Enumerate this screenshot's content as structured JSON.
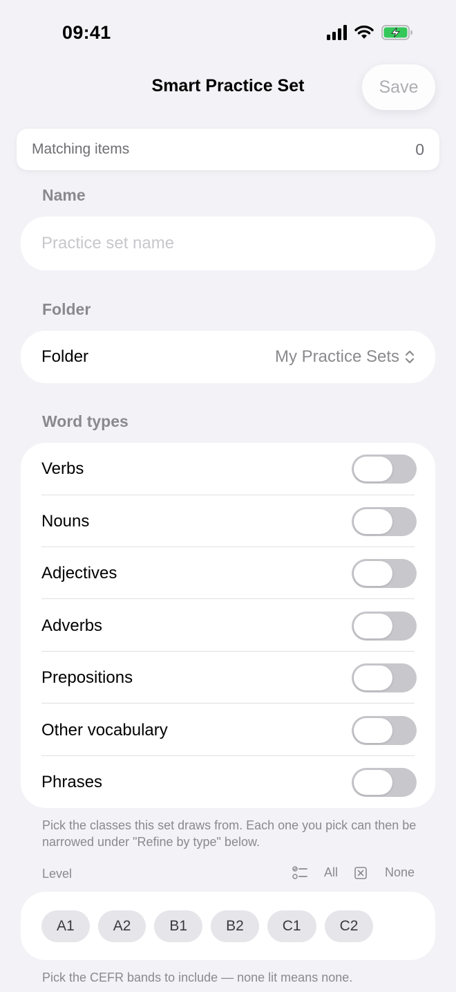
{
  "status_bar": {
    "time": "09:41"
  },
  "nav": {
    "title": "Smart Practice Set",
    "save_label": "Save"
  },
  "matching": {
    "label": "Matching items",
    "count": "0"
  },
  "name_section": {
    "header": "Name",
    "placeholder": "Practice set name",
    "value": ""
  },
  "folder_section": {
    "header": "Folder",
    "label": "Folder",
    "value": "My Practice Sets"
  },
  "word_types": {
    "header": "Word types",
    "items": [
      {
        "label": "Verbs",
        "on": false
      },
      {
        "label": "Nouns",
        "on": false
      },
      {
        "label": "Adjectives",
        "on": false
      },
      {
        "label": "Adverbs",
        "on": false
      },
      {
        "label": "Prepositions",
        "on": false
      },
      {
        "label": "Other vocabulary",
        "on": false
      },
      {
        "label": "Phrases",
        "on": false
      }
    ],
    "footnote": "Pick the classes this set draws from. Each one you pick can then be narrowed under \"Refine by type\" below."
  },
  "level": {
    "header": "Level",
    "all_label": "All",
    "none_label": "None",
    "bands": [
      "A1",
      "A2",
      "B1",
      "B2",
      "C1",
      "C2"
    ],
    "footnote": "Pick the CEFR bands to include — none lit means none."
  },
  "colors": {
    "background": "#f2f2f7",
    "toggle_off": "#c7c7cc",
    "battery_charging": "#34c759"
  }
}
